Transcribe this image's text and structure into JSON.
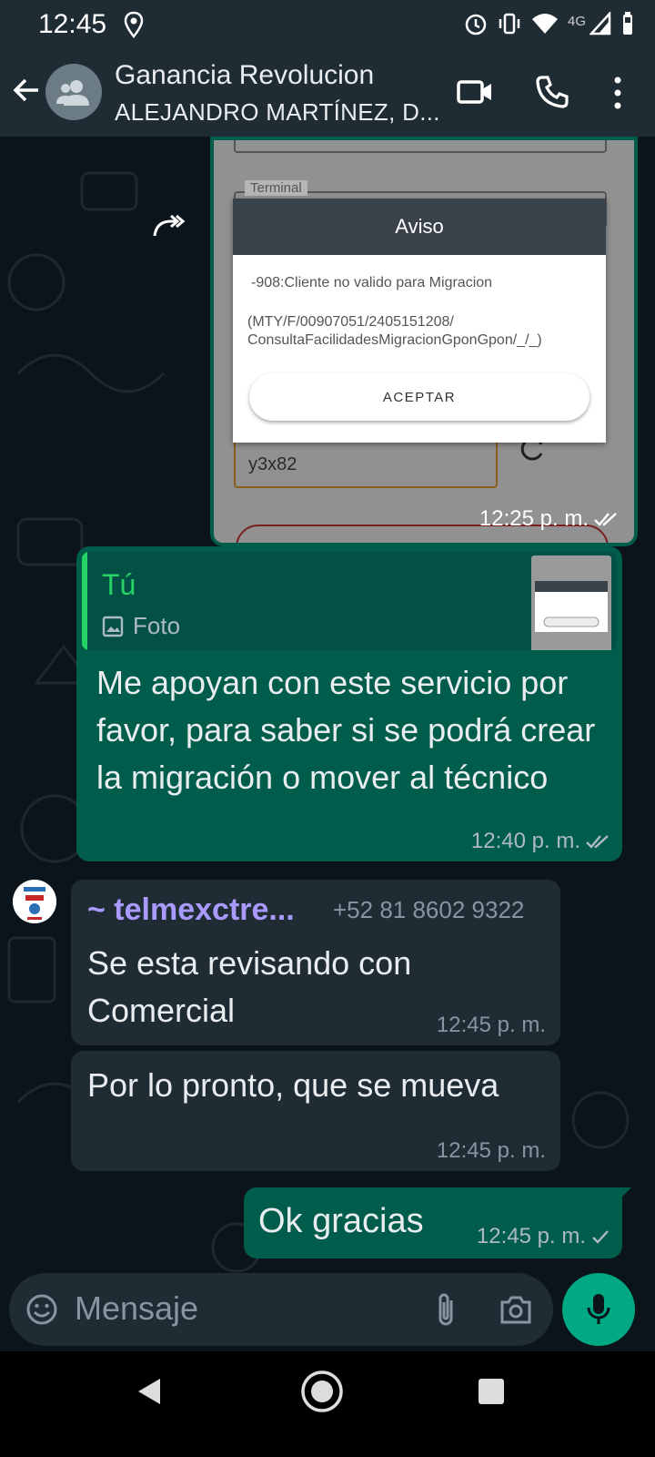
{
  "status_bar": {
    "time": "12:45",
    "network": "4G"
  },
  "header": {
    "title": "Ganancia Revolucion",
    "subtitle": "ALEJANDRO MARTÍNEZ, D...",
    "icons": [
      "back-arrow-icon",
      "group-avatar-icon",
      "video-call-icon",
      "phone-call-icon",
      "more-vert-icon"
    ]
  },
  "image_message": {
    "terminal_label": "Terminal",
    "dialog_title": "Aviso",
    "dialog_line1": "-908:Cliente no valido para Migracion",
    "dialog_line2": "(MTY/F/00907051/2405151208/ ConsultaFacilidadesMigracionGponGpon/_/_)",
    "dialog_button": "ACEPTAR",
    "field_value": "y3x82",
    "time": "12:25 p. m."
  },
  "reply_message": {
    "quote_author": "Tú",
    "quote_type": "Foto",
    "text": "Me apoyan con este servicio por favor, para saber si se podrá crear la migración o mover al técnico",
    "time": "12:40 p. m."
  },
  "incoming_1": {
    "sender": "~ telmexctre...",
    "phone": "+52 81 8602 9322",
    "text": "Se esta revisando con Comercial",
    "time": "12:45 p. m."
  },
  "incoming_2": {
    "text": "Por lo pronto, que se mueva",
    "time": "12:45 p. m."
  },
  "outgoing_2": {
    "text": "Ok gracias",
    "time": "12:45 p. m."
  },
  "input": {
    "placeholder": "Mensaje"
  },
  "colors": {
    "outgoing_bubble": "#005c4b",
    "incoming_bubble": "#202c33",
    "accent_green": "#00a884",
    "sender_name": "#a99aff"
  }
}
